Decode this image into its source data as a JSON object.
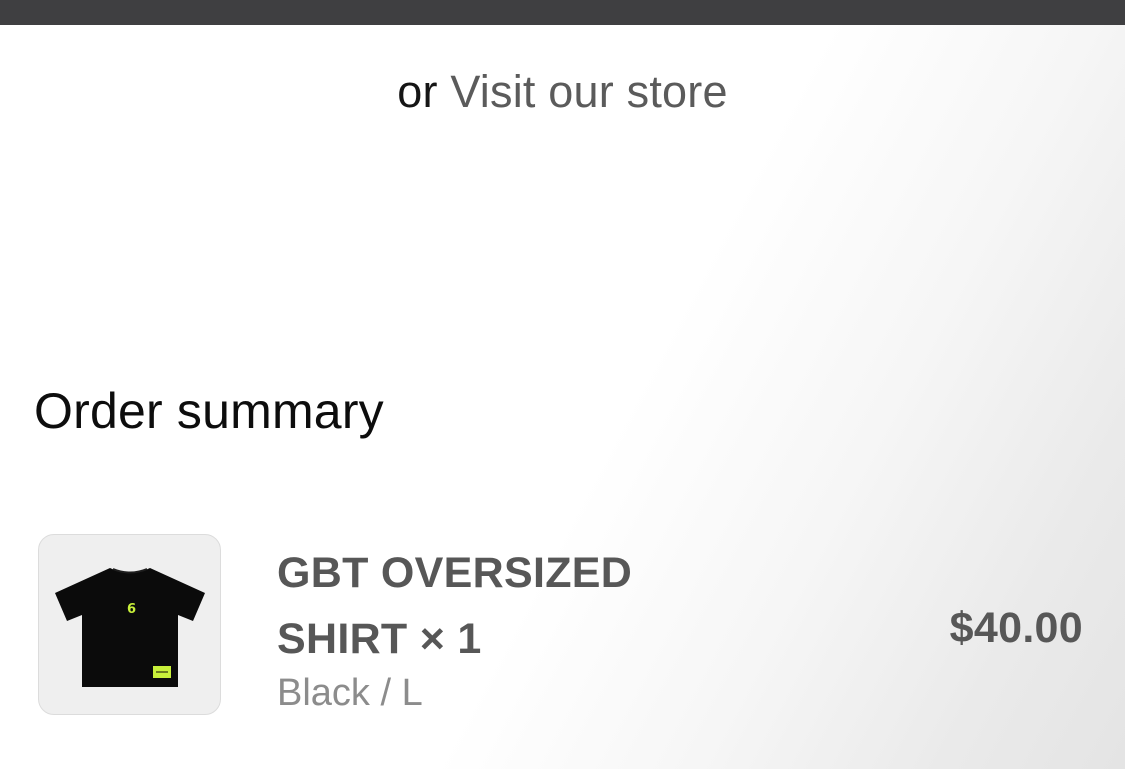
{
  "header": {
    "or_text": "or",
    "store_link_label": "Visit our store"
  },
  "order_summary": {
    "title": "Order summary",
    "items": [
      {
        "name_line1": "GBT OVERSIZED",
        "name_line2": "SHIRT",
        "quantity_text": "× 1",
        "variant": "Black / L",
        "price": "$40.00",
        "image_icon": "black-tshirt-thumbnail"
      }
    ]
  },
  "colors": {
    "top_bar": "#3f3f41",
    "product_text": "#575757",
    "variant_text": "#8c8c8c",
    "shirt": "#0b0b0b",
    "shirt_accent": "#c8f03a"
  }
}
